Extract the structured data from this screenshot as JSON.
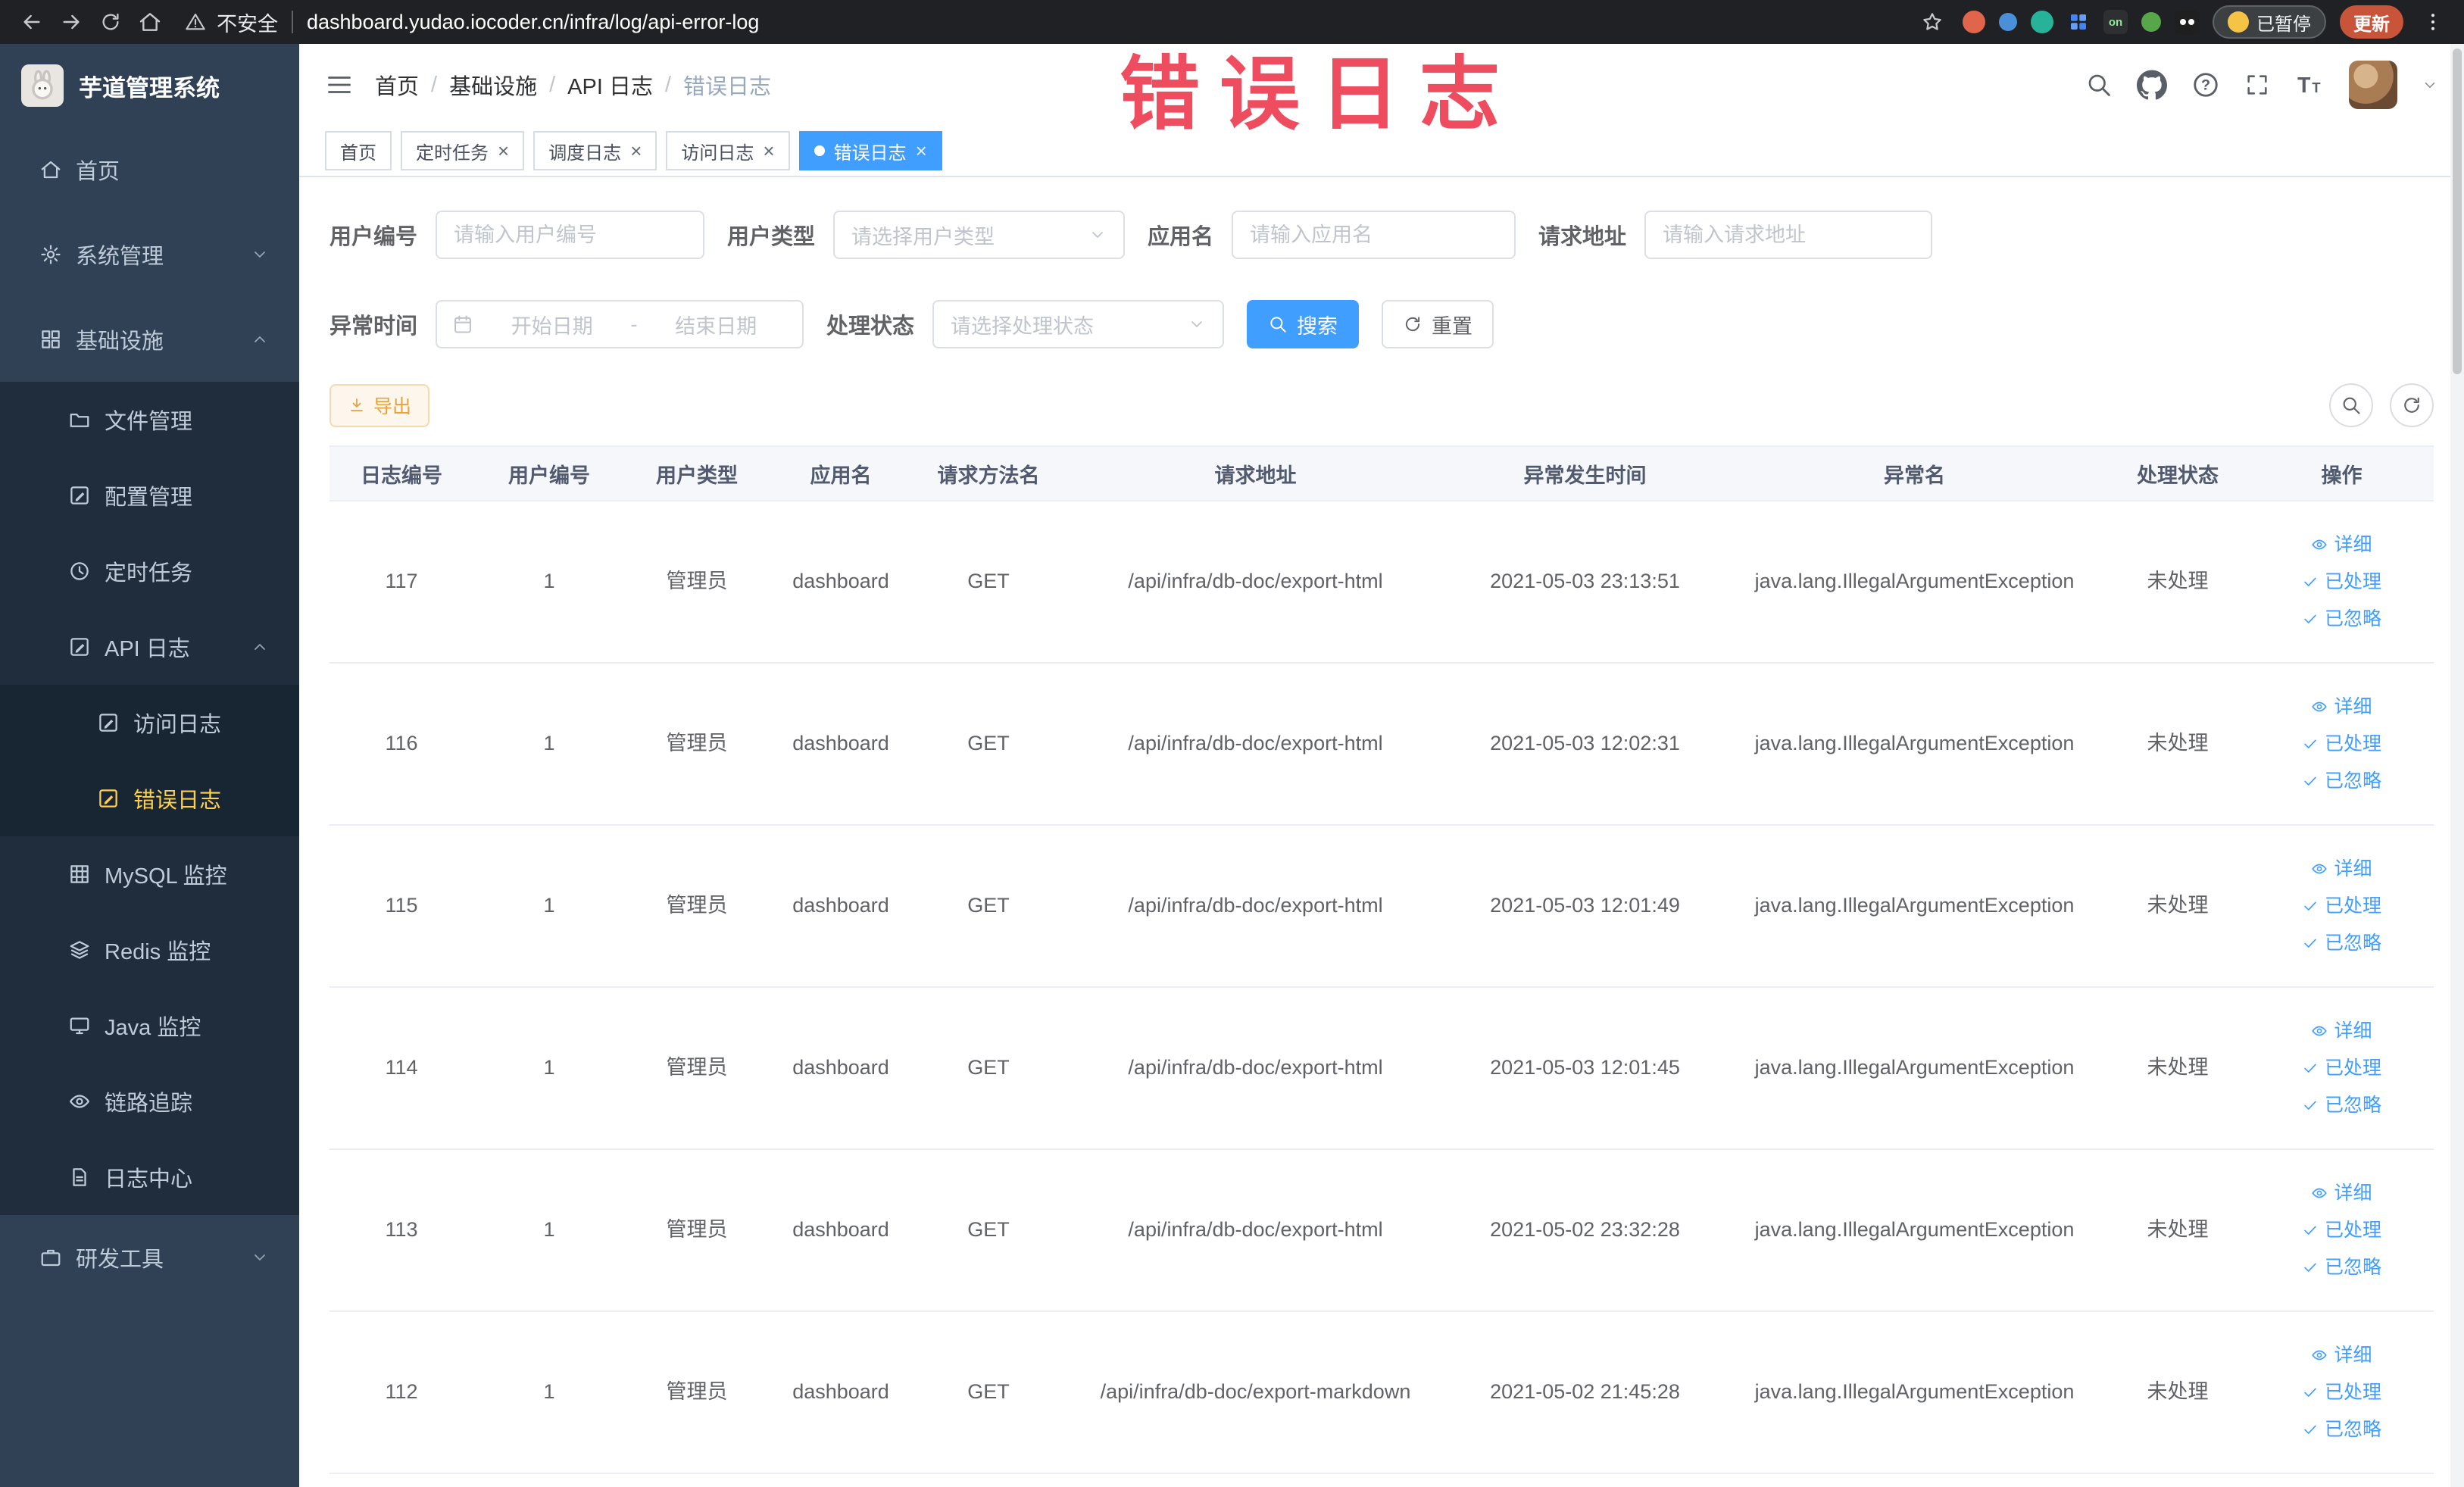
{
  "browser": {
    "security_label": "不安全",
    "url": "dashboard.yudao.iocoder.cn/infra/log/api-error-log",
    "paused_label": "已暂停",
    "update_label": "更新",
    "extension_on_badge": "on"
  },
  "sidebar": {
    "logo_title": "芋道管理系统",
    "items": [
      {
        "key": "home",
        "label": "首页",
        "icon": "home",
        "level": 1,
        "group": false,
        "active": false
      },
      {
        "key": "system-management",
        "label": "系统管理",
        "icon": "gear",
        "level": 1,
        "group": true,
        "state": "collapsed",
        "active": false
      },
      {
        "key": "infrastructure",
        "label": "基础设施",
        "icon": "grid",
        "level": 1,
        "group": true,
        "state": "expanded",
        "active": false
      },
      {
        "key": "file-management",
        "label": "文件管理",
        "icon": "folder",
        "level": 2,
        "group": false,
        "active": false
      },
      {
        "key": "config-management",
        "label": "配置管理",
        "icon": "edit",
        "level": 2,
        "group": false,
        "active": false
      },
      {
        "key": "scheduled-jobs",
        "label": "定时任务",
        "icon": "clock",
        "level": 2,
        "group": false,
        "active": false
      },
      {
        "key": "api-logs",
        "label": "API 日志",
        "icon": "edit",
        "level": 2,
        "group": true,
        "state": "expanded",
        "active": false
      },
      {
        "key": "access-log",
        "label": "访问日志",
        "icon": "edit",
        "level": 3,
        "group": false,
        "active": false
      },
      {
        "key": "error-log",
        "label": "错误日志",
        "icon": "edit",
        "level": 3,
        "group": false,
        "active": true
      },
      {
        "key": "mysql-monitor",
        "label": "MySQL 监控",
        "icon": "db",
        "level": 2,
        "group": false,
        "active": false
      },
      {
        "key": "redis-monitor",
        "label": "Redis 监控",
        "icon": "layers",
        "level": 2,
        "group": false,
        "active": false
      },
      {
        "key": "java-monitor",
        "label": "Java 监控",
        "icon": "monitor",
        "level": 2,
        "group": false,
        "active": false
      },
      {
        "key": "link-tracing",
        "label": "链路追踪",
        "icon": "eye",
        "level": 2,
        "group": false,
        "active": false
      },
      {
        "key": "log-center",
        "label": "日志中心",
        "icon": "doc",
        "level": 2,
        "group": false,
        "active": false
      },
      {
        "key": "dev-tools",
        "label": "研发工具",
        "icon": "briefcase",
        "level": 1,
        "group": true,
        "state": "collapsed",
        "active": false
      }
    ]
  },
  "header": {
    "breadcrumbs": [
      "首页",
      "基础设施",
      "API 日志",
      "错误日志"
    ]
  },
  "tabs": [
    {
      "key": "home",
      "label": "首页",
      "closable": false,
      "active": false
    },
    {
      "key": "scheduled-jobs",
      "label": "定时任务",
      "closable": true,
      "active": false
    },
    {
      "key": "schedule-log",
      "label": "调度日志",
      "closable": true,
      "active": false
    },
    {
      "key": "access-log",
      "label": "访问日志",
      "closable": true,
      "active": false
    },
    {
      "key": "error-log",
      "label": "错误日志",
      "closable": true,
      "active": true
    }
  ],
  "filters": {
    "user_id_label": "用户编号",
    "user_id_placeholder": "请输入用户编号",
    "user_type_label": "用户类型",
    "user_type_placeholder": "请选择用户类型",
    "app_name_label": "应用名",
    "app_name_placeholder": "请输入应用名",
    "request_url_label": "请求地址",
    "request_url_placeholder": "请输入请求地址",
    "exception_time_label": "异常时间",
    "start_placeholder": "开始日期",
    "range_separator": "-",
    "end_placeholder": "结束日期",
    "process_status_label": "处理状态",
    "process_status_placeholder": "请选择处理状态",
    "search_label": "搜索",
    "reset_label": "重置"
  },
  "toolbar": {
    "export_label": "导出"
  },
  "table": {
    "columns": [
      "日志编号",
      "用户编号",
      "用户类型",
      "应用名",
      "请求方法名",
      "请求地址",
      "异常发生时间",
      "异常名",
      "处理状态",
      "操作"
    ],
    "action_labels": [
      "详细",
      "已处理",
      "已忽略"
    ],
    "rows": [
      {
        "id": "117",
        "user_id": "1",
        "user_type": "管理员",
        "app": "dashboard",
        "method": "GET",
        "url": "/api/infra/db-doc/export-html",
        "time": "2021-05-03 23:13:51",
        "exception": "java.lang.IllegalArgumentException",
        "status": "未处理"
      },
      {
        "id": "116",
        "user_id": "1",
        "user_type": "管理员",
        "app": "dashboard",
        "method": "GET",
        "url": "/api/infra/db-doc/export-html",
        "time": "2021-05-03 12:02:31",
        "exception": "java.lang.IllegalArgumentException",
        "status": "未处理"
      },
      {
        "id": "115",
        "user_id": "1",
        "user_type": "管理员",
        "app": "dashboard",
        "method": "GET",
        "url": "/api/infra/db-doc/export-html",
        "time": "2021-05-03 12:01:49",
        "exception": "java.lang.IllegalArgumentException",
        "status": "未处理"
      },
      {
        "id": "114",
        "user_id": "1",
        "user_type": "管理员",
        "app": "dashboard",
        "method": "GET",
        "url": "/api/infra/db-doc/export-html",
        "time": "2021-05-03 12:01:45",
        "exception": "java.lang.IllegalArgumentException",
        "status": "未处理"
      },
      {
        "id": "113",
        "user_id": "1",
        "user_type": "管理员",
        "app": "dashboard",
        "method": "GET",
        "url": "/api/infra/db-doc/export-html",
        "time": "2021-05-02 23:32:28",
        "exception": "java.lang.IllegalArgumentException",
        "status": "未处理"
      },
      {
        "id": "112",
        "user_id": "1",
        "user_type": "管理员",
        "app": "dashboard",
        "method": "GET",
        "url": "/api/infra/db-doc/export-markdown",
        "time": "2021-05-02 21:45:28",
        "exception": "java.lang.IllegalArgumentException",
        "status": "未处理"
      }
    ]
  },
  "annotation": {
    "text": "错误日志",
    "color": "#ee4458"
  },
  "colors": {
    "accent": "#409eff",
    "warning": "#e6a23c",
    "sidebar_bg": "#304156",
    "sidebar_active": "#ffd04b"
  }
}
